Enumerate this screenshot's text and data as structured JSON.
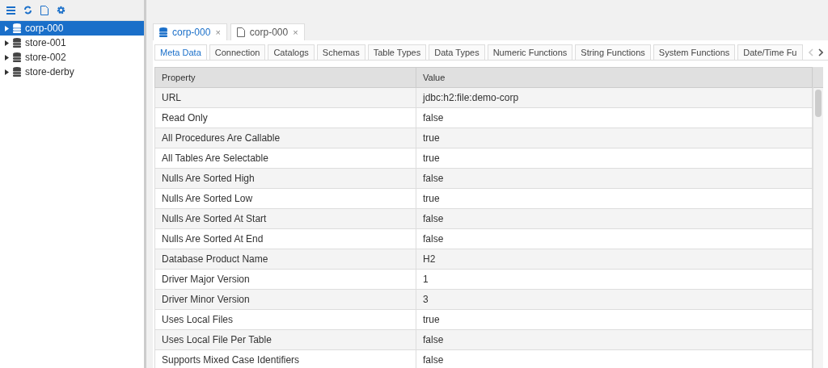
{
  "tree": {
    "items": [
      {
        "label": "corp-000",
        "selected": true
      },
      {
        "label": "store-001",
        "selected": false
      },
      {
        "label": "store-002",
        "selected": false
      },
      {
        "label": "store-derby",
        "selected": false
      }
    ]
  },
  "doc_tabs": [
    {
      "label": "corp-000",
      "kind": "database",
      "selected": true,
      "close": "×"
    },
    {
      "label": "corp-000",
      "kind": "file",
      "selected": false,
      "close": "×"
    }
  ],
  "tabs": [
    {
      "label": "Meta Data",
      "selected": true
    },
    {
      "label": "Connection",
      "selected": false
    },
    {
      "label": "Catalogs",
      "selected": false
    },
    {
      "label": "Schemas",
      "selected": false
    },
    {
      "label": "Table Types",
      "selected": false
    },
    {
      "label": "Data Types",
      "selected": false
    },
    {
      "label": "Numeric Functions",
      "selected": false
    },
    {
      "label": "String Functions",
      "selected": false
    },
    {
      "label": "System Functions",
      "selected": false
    },
    {
      "label": "Date/Time Fu",
      "selected": false
    }
  ],
  "tab_scroll": {
    "left_disabled": true,
    "right_disabled": false
  },
  "table": {
    "columns": [
      "Property",
      "Value"
    ],
    "rows": [
      [
        "URL",
        "jdbc:h2:file:demo-corp"
      ],
      [
        "Read Only",
        "false"
      ],
      [
        "All Procedures Are Callable",
        "true"
      ],
      [
        "All Tables Are Selectable",
        "true"
      ],
      [
        "Nulls Are Sorted High",
        "false"
      ],
      [
        "Nulls Are Sorted Low",
        "true"
      ],
      [
        "Nulls Are Sorted At Start",
        "false"
      ],
      [
        "Nulls Are Sorted At End",
        "false"
      ],
      [
        "Database Product Name",
        "H2"
      ],
      [
        "Driver Major Version",
        "1"
      ],
      [
        "Driver Minor Version",
        "3"
      ],
      [
        "Uses Local Files",
        "true"
      ],
      [
        "Uses Local File Per Table",
        "false"
      ],
      [
        "Supports Mixed Case Identifiers",
        "false"
      ]
    ]
  }
}
